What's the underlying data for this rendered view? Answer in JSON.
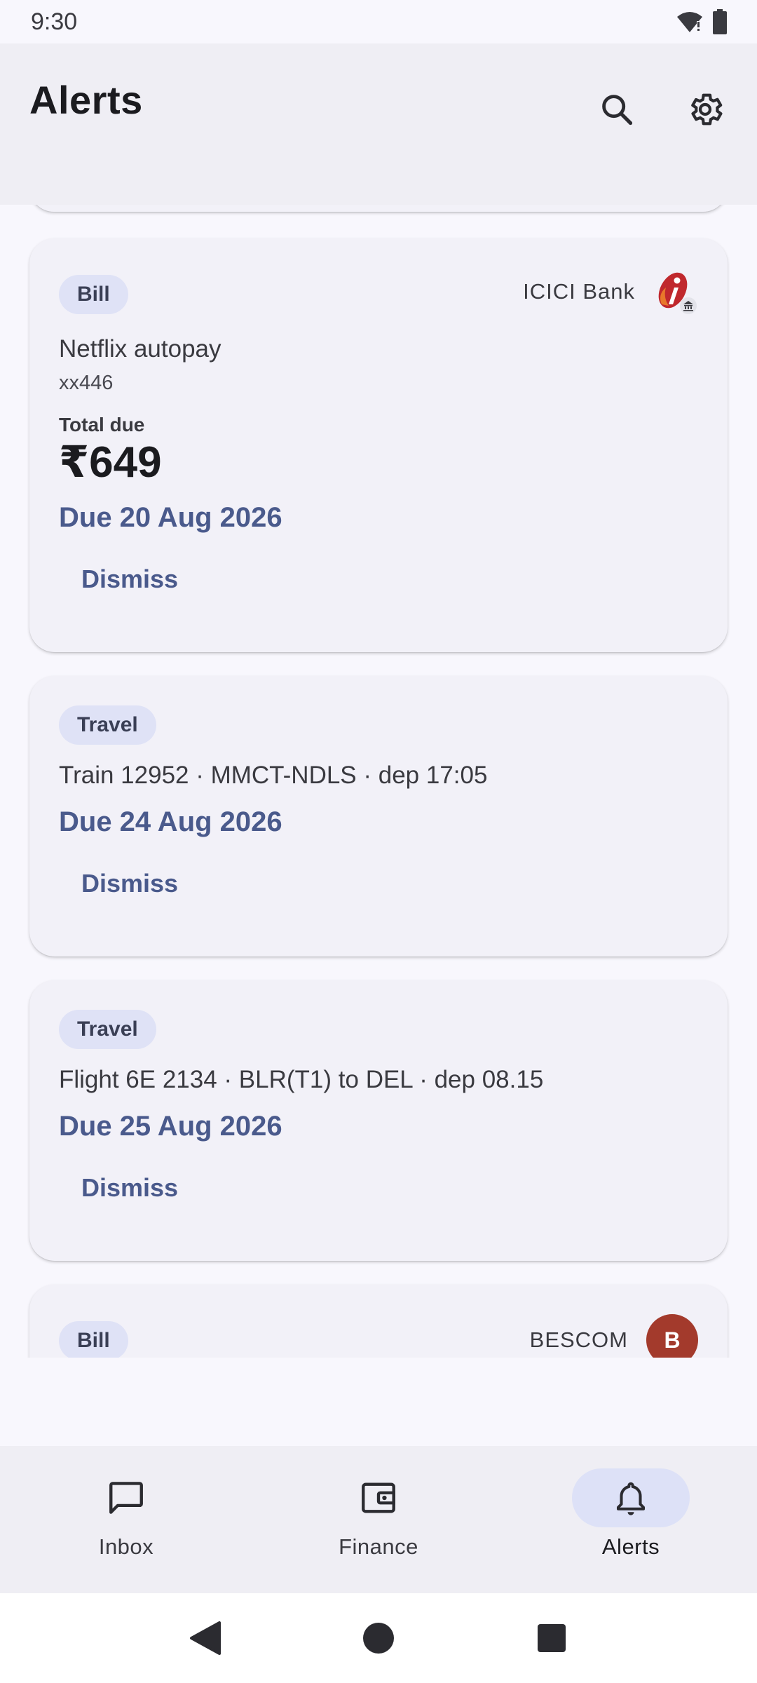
{
  "status_bar": {
    "time": "9:30"
  },
  "header": {
    "title": "Alerts"
  },
  "alerts": [
    {
      "chip": "Bill",
      "issuer": "ICICI Bank",
      "title": "Netflix autopay",
      "subtitle": "xx446",
      "due_label": "Total due",
      "amount": "₹649",
      "due": "Due 20 Aug 2026",
      "action": "Dismiss"
    },
    {
      "chip": "Travel",
      "title": "Train 12952 · MMCT-NDLS · dep 17:05",
      "due": "Due 24 Aug 2026",
      "action": "Dismiss"
    },
    {
      "chip": "Travel",
      "title": "Flight 6E 2134 · BLR(T1) to DEL · dep 08.15",
      "due": "Due 25 Aug 2026",
      "action": "Dismiss"
    },
    {
      "chip": "Bill",
      "issuer": "BESCOM",
      "avatar_letter": "B"
    }
  ],
  "bottom_nav": [
    {
      "label": "Inbox",
      "icon": "chat-bubble-icon",
      "active": false
    },
    {
      "label": "Finance",
      "icon": "wallet-icon",
      "active": false
    },
    {
      "label": "Alerts",
      "icon": "bell-icon",
      "active": true
    }
  ],
  "colors": {
    "accent": "#4A5A8C",
    "chip_bg": "#DFE2F6",
    "card_bg": "#F2F1F8",
    "avatar_bescom": "#A33A2C",
    "icici_logo": "#C0282D"
  }
}
